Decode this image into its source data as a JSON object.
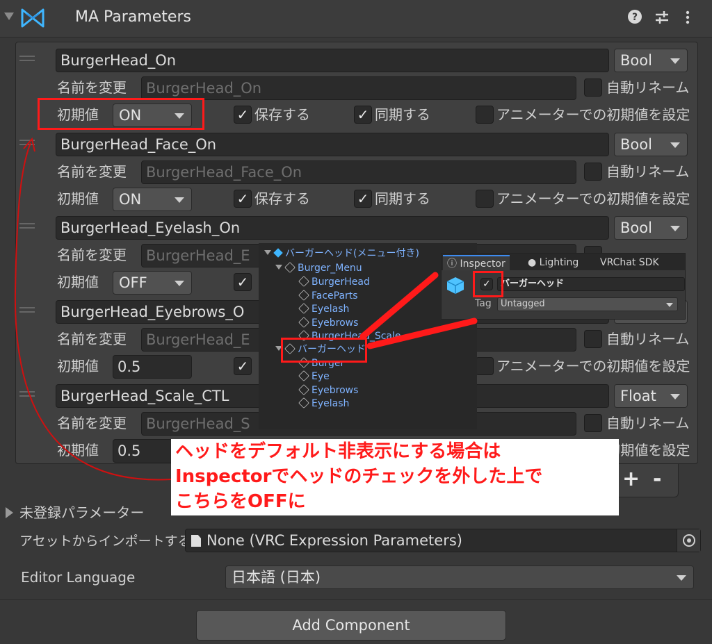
{
  "component": {
    "title": "MA Parameters",
    "icons": [
      "help-icon",
      "preset-icon",
      "more-vert-icon"
    ]
  },
  "labels": {
    "rename": "名前を変更",
    "default_value": "初期値",
    "saved": "保存する",
    "synced": "同期する",
    "auto_rename": "自動リネーム",
    "animator_default": "アニメーターでの初期値を設定"
  },
  "parameters": [
    {
      "name": "BurgerHead_On",
      "type": "Bool",
      "rename_placeholder": "BurgerHead_On",
      "default": "ON",
      "default_kind": "dropdown",
      "saved": true,
      "synced": true,
      "auto_rename": false,
      "animator_default": false
    },
    {
      "name": "BurgerHead_Face_On",
      "type": "Bool",
      "rename_placeholder": "BurgerHead_Face_On",
      "default": "ON",
      "default_kind": "dropdown",
      "saved": true,
      "synced": true,
      "auto_rename": false,
      "animator_default": false
    },
    {
      "name": "BurgerHead_Eyelash_On",
      "type": "Bool",
      "rename_placeholder": "BurgerHead_E",
      "default": "OFF",
      "default_kind": "dropdown",
      "saved": true,
      "synced": true,
      "auto_rename": false,
      "animator_default": false
    },
    {
      "name": "BurgerHead_Eyebrows_O",
      "type": "",
      "rename_placeholder": "BurgerHead_E",
      "default": "0.5",
      "default_kind": "field",
      "saved": true,
      "synced": true,
      "auto_rename": false,
      "animator_default": false
    },
    {
      "name": "BurgerHead_Scale_CTL",
      "type": "Float",
      "rename_placeholder": "BurgerHead_S",
      "default": "0.5",
      "default_kind": "field",
      "saved": true,
      "synced": true,
      "auto_rename": false,
      "animator_default": false
    }
  ],
  "list_footer": {
    "add": "+",
    "remove": "-"
  },
  "unregistered": {
    "label": "未登録パラメーター"
  },
  "import": {
    "label": "アセットからインポートする",
    "value": "None (VRC Expression Parameters)"
  },
  "editor_language": {
    "label": "Editor Language",
    "value": "日本語 (日本)"
  },
  "add_component": {
    "label": "Add Component"
  },
  "hierarchy": {
    "root": "バーガーヘッド(メニュー付き)",
    "menu": "Burger_Menu",
    "menu_children": [
      "BurgerHead",
      "FaceParts",
      "Eyelash",
      "Eyebrows",
      "BurgerHead_Scale"
    ],
    "selected": "バーガーヘッド",
    "selected_children": [
      "Burger",
      "Eye",
      "Eyebrows",
      "Eyelash"
    ]
  },
  "inspector": {
    "tabs": [
      "Inspector",
      "Lighting",
      "VRChat SDK"
    ],
    "object_name": "バーガーヘッド",
    "active": true,
    "tag_label": "Tag",
    "tag_value": "Untagged"
  },
  "annotation": {
    "lines": [
      "ヘッドをデフォルト非表示にする場合は",
      "Inspectorでヘッドのチェックを外した上で",
      "こちらをOFFに"
    ]
  },
  "colors": {
    "annotation": "#ff1a1a",
    "selection_box": "#ff1a1a",
    "link_blue": "#7fb3ff",
    "accent_tab": "#3d8bf0"
  }
}
